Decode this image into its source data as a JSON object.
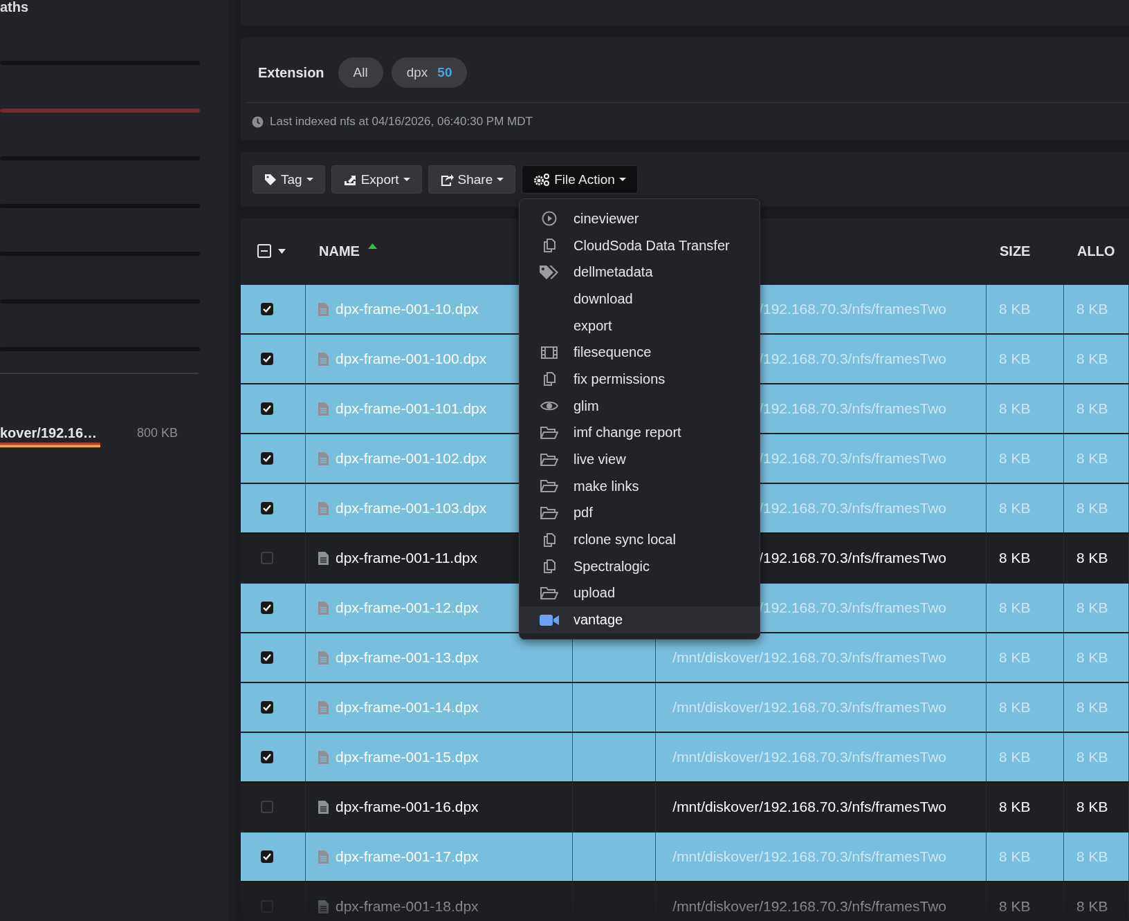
{
  "sidebar": {
    "title": "aths",
    "items": [
      {
        "name": "kover/192.16…",
        "size": "800 KB",
        "level": 0.5
      }
    ]
  },
  "filters": {
    "label": "Extension",
    "chips": [
      {
        "label": "All"
      },
      {
        "label": "dpx",
        "count": "50"
      }
    ]
  },
  "index_status": "Last indexed nfs at 04/16/2026, 06:40:30 PM MDT",
  "toolbar": [
    {
      "label": "Tag",
      "kind": "tag",
      "open": false
    },
    {
      "label": "Export",
      "kind": "export",
      "open": false
    },
    {
      "label": "Share",
      "kind": "share",
      "open": false
    },
    {
      "label": "File Action",
      "kind": "gears",
      "open": true
    }
  ],
  "menu": [
    {
      "label": "cineviewer",
      "kind": "play",
      "selected": false
    },
    {
      "label": "CloudSoda Data Transfer",
      "kind": "copy",
      "selected": false
    },
    {
      "label": "dellmetadata",
      "kind": "tags",
      "selected": false
    },
    {
      "label": "download",
      "kind": "plain",
      "selected": false
    },
    {
      "label": "export",
      "kind": "plain",
      "selected": false
    },
    {
      "label": "filesequence",
      "kind": "film",
      "selected": false
    },
    {
      "label": "fix permissions",
      "kind": "copy",
      "selected": false
    },
    {
      "label": "glim",
      "kind": "eye",
      "selected": false
    },
    {
      "label": "imf change report",
      "kind": "folder",
      "selected": false
    },
    {
      "label": "live view",
      "kind": "folder",
      "selected": false
    },
    {
      "label": "make links",
      "kind": "folder",
      "selected": false
    },
    {
      "label": "pdf",
      "kind": "folder",
      "selected": false
    },
    {
      "label": "rclone sync local",
      "kind": "copy",
      "selected": false
    },
    {
      "label": "Spectralogic",
      "kind": "copy",
      "selected": false
    },
    {
      "label": "upload",
      "kind": "folder",
      "selected": false
    },
    {
      "label": "vantage",
      "kind": "video",
      "selected": true
    }
  ],
  "table": {
    "columns": [
      {
        "label": "NAME",
        "sorted": true
      },
      {
        "label": "SIZE",
        "sorted": false
      },
      {
        "label": "ALLO",
        "sorted": false
      }
    ],
    "rows": [
      {
        "name": "dpx-frame-001-10.dpx",
        "path": "/192.168.70.3/nfs/framesTwo",
        "size": "8 KB",
        "allocated": "8 KB",
        "selected": true
      },
      {
        "name": "dpx-frame-001-100.dpx",
        "path": "/192.168.70.3/nfs/framesTwo",
        "size": "8 KB",
        "allocated": "8 KB",
        "selected": true
      },
      {
        "name": "dpx-frame-001-101.dpx",
        "path": "/192.168.70.3/nfs/framesTwo",
        "size": "8 KB",
        "allocated": "8 KB",
        "selected": true
      },
      {
        "name": "dpx-frame-001-102.dpx",
        "path": "/192.168.70.3/nfs/framesTwo",
        "size": "8 KB",
        "allocated": "8 KB",
        "selected": true
      },
      {
        "name": "dpx-frame-001-103.dpx",
        "path": "/192.168.70.3/nfs/framesTwo",
        "size": "8 KB",
        "allocated": "8 KB",
        "selected": true
      },
      {
        "name": "dpx-frame-001-11.dpx",
        "path": "/192.168.70.3/nfs/framesTwo",
        "size": "8 KB",
        "allocated": "8 KB",
        "selected": false
      },
      {
        "name": "dpx-frame-001-12.dpx",
        "path": "/192.168.70.3/nfs/framesTwo",
        "size": "8 KB",
        "allocated": "8 KB",
        "selected": true
      },
      {
        "name": "dpx-frame-001-13.dpx",
        "path": "/mnt/diskover/192.168.70.3/nfs/framesTwo",
        "size": "8 KB",
        "allocated": "8 KB",
        "selected": true
      },
      {
        "name": "dpx-frame-001-14.dpx",
        "path": "/mnt/diskover/192.168.70.3/nfs/framesTwo",
        "size": "8 KB",
        "allocated": "8 KB",
        "selected": true
      },
      {
        "name": "dpx-frame-001-15.dpx",
        "path": "/mnt/diskover/192.168.70.3/nfs/framesTwo",
        "size": "8 KB",
        "allocated": "8 KB",
        "selected": true
      },
      {
        "name": "dpx-frame-001-16.dpx",
        "path": "/mnt/diskover/192.168.70.3/nfs/framesTwo",
        "size": "8 KB",
        "allocated": "8 KB",
        "selected": false
      },
      {
        "name": "dpx-frame-001-17.dpx",
        "path": "/mnt/diskover/192.168.70.3/nfs/framesTwo",
        "size": "8 KB",
        "allocated": "8 KB",
        "selected": true
      },
      {
        "name": "dpx-frame-001-18.dpx",
        "path": "/mnt/diskover/192.168.70.3/nfs/framesTwo",
        "size": "8 KB",
        "allocated": "8 KB",
        "selected": false
      }
    ]
  }
}
